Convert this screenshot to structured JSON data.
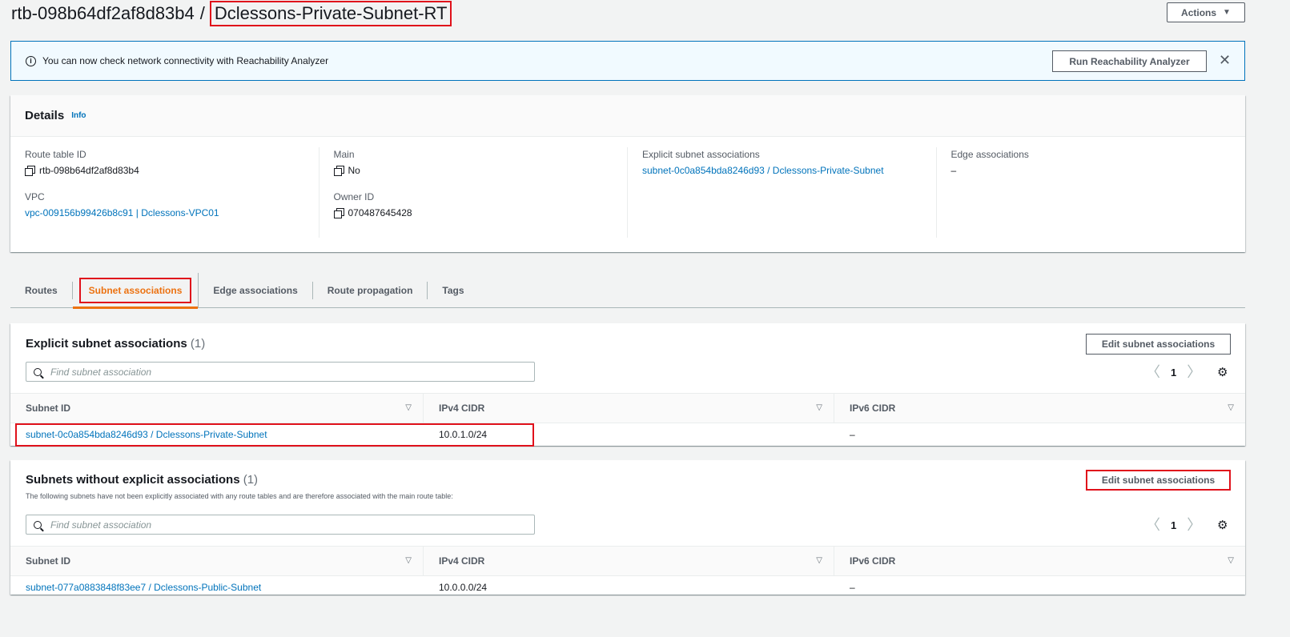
{
  "header": {
    "route_table_id": "rtb-098b64df2af8d83b4",
    "separator": "/",
    "route_table_name": "Dclessons-Private-Subnet-RT",
    "actions_label": "Actions"
  },
  "banner": {
    "message": "You can now check network connectivity with Reachability Analyzer",
    "button_label": "Run Reachability Analyzer"
  },
  "details": {
    "title": "Details",
    "info_label": "Info",
    "route_table_id_label": "Route table ID",
    "route_table_id_value": "rtb-098b64df2af8d83b4",
    "vpc_label": "VPC",
    "vpc_value": "vpc-009156b99426b8c91 | Dclessons-VPC01",
    "main_label": "Main",
    "main_value": "No",
    "owner_id_label": "Owner ID",
    "owner_id_value": "070487645428",
    "explicit_label": "Explicit subnet associations",
    "explicit_value": "subnet-0c0a854bda8246d93 / Dclessons-Private-Subnet",
    "edge_label": "Edge associations",
    "edge_value": "–"
  },
  "tabs": [
    {
      "label": "Routes"
    },
    {
      "label": "Subnet associations"
    },
    {
      "label": "Edge associations"
    },
    {
      "label": "Route propagation"
    },
    {
      "label": "Tags"
    }
  ],
  "explicit_panel": {
    "title": "Explicit subnet associations",
    "count": "(1)",
    "edit_label": "Edit subnet associations",
    "search_placeholder": "Find subnet association",
    "page": "1",
    "columns": [
      "Subnet ID",
      "IPv4 CIDR",
      "IPv6 CIDR"
    ],
    "rows": [
      {
        "subnet": "subnet-0c0a854bda8246d93 / Dclessons-Private-Subnet",
        "ipv4": "10.0.1.0/24",
        "ipv6": "–"
      }
    ]
  },
  "implicit_panel": {
    "title": "Subnets without explicit associations",
    "count": "(1)",
    "description": "The following subnets have not been explicitly associated with any route tables and are therefore associated with the main route table:",
    "edit_label": "Edit subnet associations",
    "search_placeholder": "Find subnet association",
    "page": "1",
    "columns": [
      "Subnet ID",
      "IPv4 CIDR",
      "IPv6 CIDR"
    ],
    "rows": [
      {
        "subnet": "subnet-077a0883848f83ee7 / Dclessons-Public-Subnet",
        "ipv4": "10.0.0.0/24",
        "ipv6": "–"
      }
    ]
  },
  "colors": {
    "accent": "#ec7211",
    "link": "#0073bb",
    "highlight": "#e0111b"
  }
}
